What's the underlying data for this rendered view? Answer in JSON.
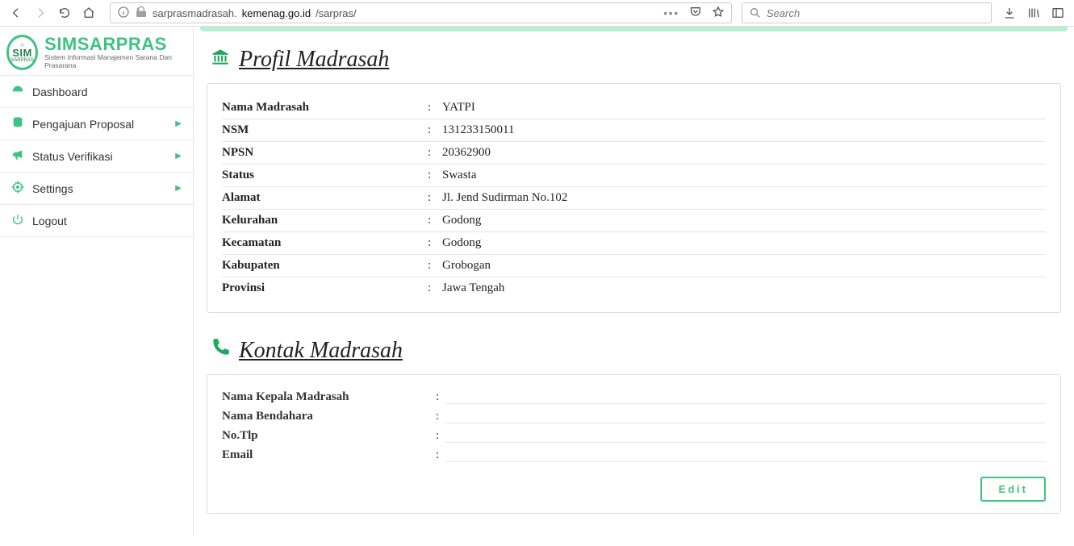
{
  "browser": {
    "url_prefix": "sarprasmadrasah.",
    "url_host": "kemenag.go.id",
    "url_path": "/sarpras/",
    "search_placeholder": "Search"
  },
  "brand": {
    "logo_top": "⌂",
    "logo_mid": "SIM",
    "logo_bot": "SARPRAS",
    "title": "SIMSARPRAS",
    "subtitle": "Sistem Informasi Manajemen Sarana Dan Prasarana"
  },
  "nav": {
    "items": [
      {
        "label": "Dashboard",
        "expandable": false
      },
      {
        "label": "Pengajuan Proposal",
        "expandable": true
      },
      {
        "label": "Status Verifikasi",
        "expandable": true
      },
      {
        "label": "Settings",
        "expandable": true
      },
      {
        "label": "Logout",
        "expandable": false
      }
    ]
  },
  "sections": {
    "profil_title": "Profil Madrasah",
    "kontak_title": "Kontak Madrasah"
  },
  "profil": {
    "rows": [
      {
        "label": "Nama Madrasah",
        "value": "YATPI"
      },
      {
        "label": "NSM",
        "value": "131233150011"
      },
      {
        "label": "NPSN",
        "value": "20362900"
      },
      {
        "label": "Status",
        "value": "Swasta"
      },
      {
        "label": "Alamat",
        "value": "Jl. Jend Sudirman No.102"
      },
      {
        "label": "Kelurahan",
        "value": "Godong"
      },
      {
        "label": "Kecamatan",
        "value": "Godong"
      },
      {
        "label": "Kabupaten",
        "value": "Grobogan"
      },
      {
        "label": "Provinsi",
        "value": "Jawa Tengah"
      }
    ]
  },
  "kontak": {
    "rows": [
      {
        "label": "Nama Kepala Madrasah",
        "value": ""
      },
      {
        "label": "Nama Bendahara",
        "value": ""
      },
      {
        "label": "No.Tlp",
        "value": ""
      },
      {
        "label": "Email",
        "value": ""
      }
    ],
    "edit_label": "Edit"
  }
}
